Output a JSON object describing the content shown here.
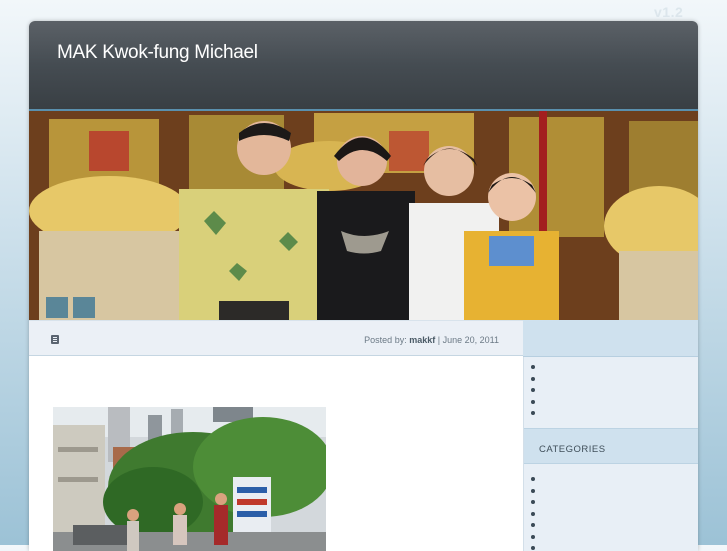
{
  "version": "v1.2",
  "site": {
    "title": "MAK Kwok-fung Michael"
  },
  "banner": {
    "slider_buttons": [
      "slide-1",
      "slide-2"
    ]
  },
  "post": {
    "meta_prefix": "Posted by:",
    "author": "makkf",
    "separator": "|",
    "date": "June 20, 2011",
    "icon": "post-format-icon"
  },
  "sidebar": {
    "list_a_count": 5,
    "categories_heading": "CATEGORIES",
    "list_b_count": 7
  },
  "colors": {
    "header_bg": "#454c52",
    "accent_blue": "#5a90ae",
    "sidebar_bg": "#e8eff6",
    "meta_bar_bg": "#ebf0f6"
  }
}
